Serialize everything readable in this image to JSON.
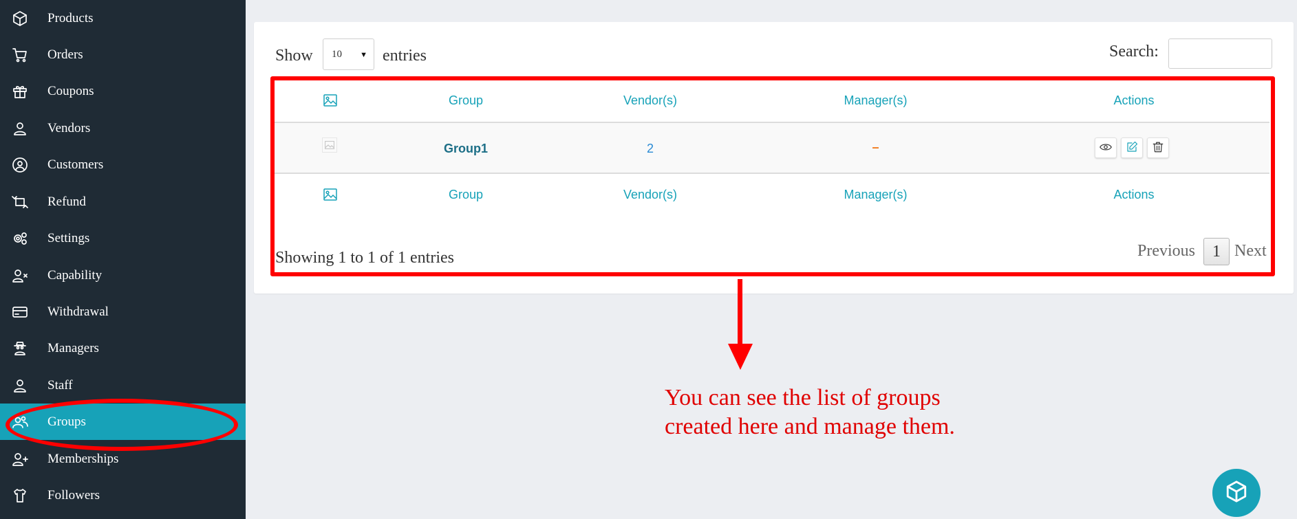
{
  "sidebar": {
    "items": [
      {
        "label": "Products",
        "icon": "cube-icon"
      },
      {
        "label": "Orders",
        "icon": "cart-icon"
      },
      {
        "label": "Coupons",
        "icon": "gift-icon"
      },
      {
        "label": "Vendors",
        "icon": "user-icon"
      },
      {
        "label": "Customers",
        "icon": "user-circle-icon"
      },
      {
        "label": "Refund",
        "icon": "refund-icon"
      },
      {
        "label": "Settings",
        "icon": "gears-icon"
      },
      {
        "label": "Capability",
        "icon": "user-x-icon"
      },
      {
        "label": "Withdrawal",
        "icon": "credit-card-icon"
      },
      {
        "label": "Managers",
        "icon": "user-secret-icon"
      },
      {
        "label": "Staff",
        "icon": "user-icon"
      },
      {
        "label": "Groups",
        "icon": "users-icon",
        "active": true
      },
      {
        "label": "Memberships",
        "icon": "user-plus-icon"
      },
      {
        "label": "Followers",
        "icon": "shirt-icon"
      }
    ],
    "active_color": "#17a2b8",
    "background": "#1f2b35"
  },
  "table_controls": {
    "show_label": "Show",
    "entries_value": "10",
    "entries_label": "entries",
    "search_label": "Search:",
    "search_value": ""
  },
  "table": {
    "columns": [
      "Group",
      "Vendor(s)",
      "Manager(s)",
      "Actions"
    ],
    "image_column_icon": "image-icon",
    "rows": [
      {
        "group": "Group1",
        "vendors": "2",
        "managers": "–",
        "actions": [
          "view-icon",
          "edit-icon",
          "delete-icon"
        ]
      }
    ],
    "footer_columns": [
      "Group",
      "Vendor(s)",
      "Manager(s)",
      "Actions"
    ]
  },
  "pagination": {
    "info": "Showing 1 to 1 of 1 entries",
    "previous": "Previous",
    "current_page": "1",
    "next": "Next"
  },
  "annotation": {
    "line1": "You can see the list of groups",
    "line2": "created here and manage them.",
    "color": "#ff0000"
  },
  "fab": {
    "icon": "cube-icon"
  }
}
